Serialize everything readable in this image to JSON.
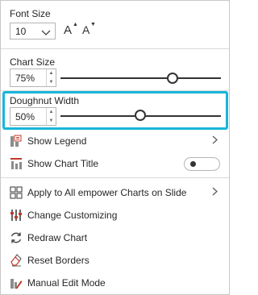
{
  "font_size": {
    "label": "Font Size",
    "value": "10",
    "grow_label": "A",
    "shrink_label": "A",
    "grow_arrow": "▲",
    "shrink_arrow": "▼"
  },
  "chart_size": {
    "label": "Chart Size",
    "value": "75%",
    "slider_level": 0.75
  },
  "doughnut_width": {
    "label": "Doughnut Width",
    "value": "50%",
    "slider_level": 0.5
  },
  "menu": {
    "show_legend": "Show Legend",
    "show_chart_title": "Show Chart Title",
    "show_chart_title_toggle": "off",
    "apply_all": "Apply to All empower Charts on Slide",
    "change_customizing": "Change Customizing",
    "redraw_chart": "Redraw Chart",
    "reset_borders": "Reset Borders",
    "manual_edit": "Manual Edit Mode"
  },
  "colors": {
    "highlight": "#19b5d9",
    "accent_red": "#c0392b",
    "text": "#262626"
  },
  "icons": {
    "spin_up": "▲",
    "spin_down": "▼",
    "names": [
      "chevron-down-icon",
      "legend-icon",
      "chart-title-icon",
      "apply-grid-icon",
      "customizing-icon",
      "redraw-icon",
      "reset-borders-icon",
      "manual-edit-icon",
      "chevron-right-icon"
    ]
  }
}
